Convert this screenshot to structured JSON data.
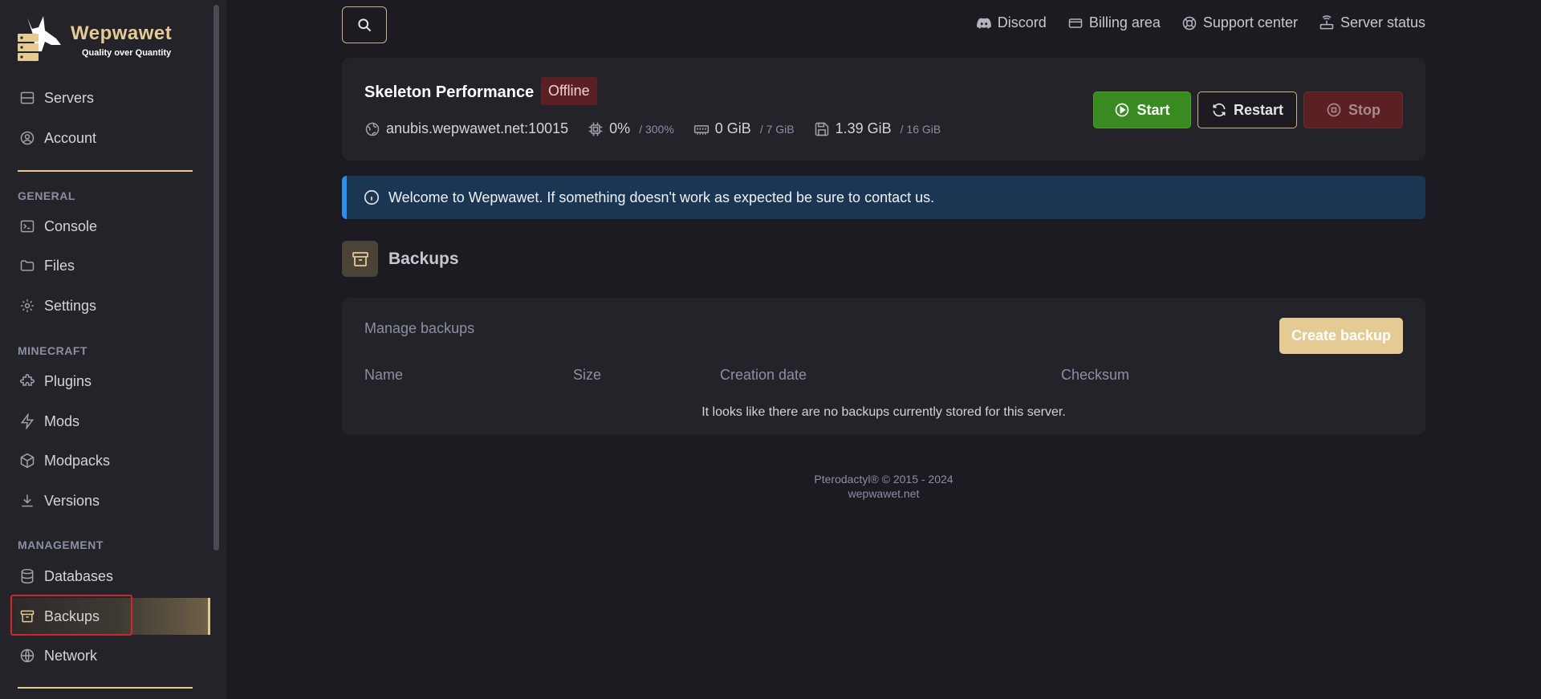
{
  "brand": {
    "name": "Wepwawet",
    "tagline": "Quality over Quantity"
  },
  "sidebar": {
    "top_items": [
      {
        "label": "Servers",
        "icon": "server-icon"
      },
      {
        "label": "Account",
        "icon": "user-circle-icon"
      }
    ],
    "sections": [
      {
        "label": "GENERAL",
        "items": [
          {
            "label": "Console",
            "icon": "terminal-icon"
          },
          {
            "label": "Files",
            "icon": "folder-icon"
          },
          {
            "label": "Settings",
            "icon": "gear-icon"
          }
        ]
      },
      {
        "label": "MINECRAFT",
        "items": [
          {
            "label": "Plugins",
            "icon": "puzzle-icon"
          },
          {
            "label": "Mods",
            "icon": "bolt-icon"
          },
          {
            "label": "Modpacks",
            "icon": "cube-icon"
          },
          {
            "label": "Versions",
            "icon": "download-icon"
          }
        ]
      },
      {
        "label": "MANAGEMENT",
        "items": [
          {
            "label": "Databases",
            "icon": "database-icon"
          },
          {
            "label": "Backups",
            "icon": "archive-icon",
            "active": true
          },
          {
            "label": "Network",
            "icon": "globe-icon"
          }
        ]
      }
    ]
  },
  "search": {
    "icon": "search-icon"
  },
  "header_links": [
    {
      "label": "Discord",
      "icon": "discord-icon"
    },
    {
      "label": "Billing area",
      "icon": "credit-card-icon"
    },
    {
      "label": "Support center",
      "icon": "lifebuoy-icon"
    },
    {
      "label": "Server status",
      "icon": "router-icon"
    }
  ],
  "server": {
    "name": "Skeleton Performance",
    "status": "Offline",
    "address": "anubis.wepwawet.net:10015",
    "cpu": {
      "value": "0%",
      "limit": "/ 300%"
    },
    "memory": {
      "value": "0 GiB",
      "limit": "/ 7 GiB"
    },
    "disk": {
      "value": "1.39 GiB",
      "limit": "/ 16 GiB"
    },
    "buttons": {
      "start": "Start",
      "restart": "Restart",
      "stop": "Stop"
    }
  },
  "alert": {
    "text": "Welcome to Wepwawet. If something doesn't work as expected be sure to contact us."
  },
  "page": {
    "title": "Backups"
  },
  "backups": {
    "heading": "Manage backups",
    "create_label": "Create backup",
    "columns": [
      "Name",
      "Size",
      "Creation date",
      "Checksum"
    ],
    "empty_text": "It looks like there are no backups currently stored for this server."
  },
  "footer": {
    "copyright": "Pterodactyl® © 2015 - 2024",
    "domain": "wepwawet.net"
  },
  "colors": {
    "accent": "#e3cb93",
    "start": "#3a8a22",
    "offline": "#5a2024",
    "info": "#1b3653"
  }
}
